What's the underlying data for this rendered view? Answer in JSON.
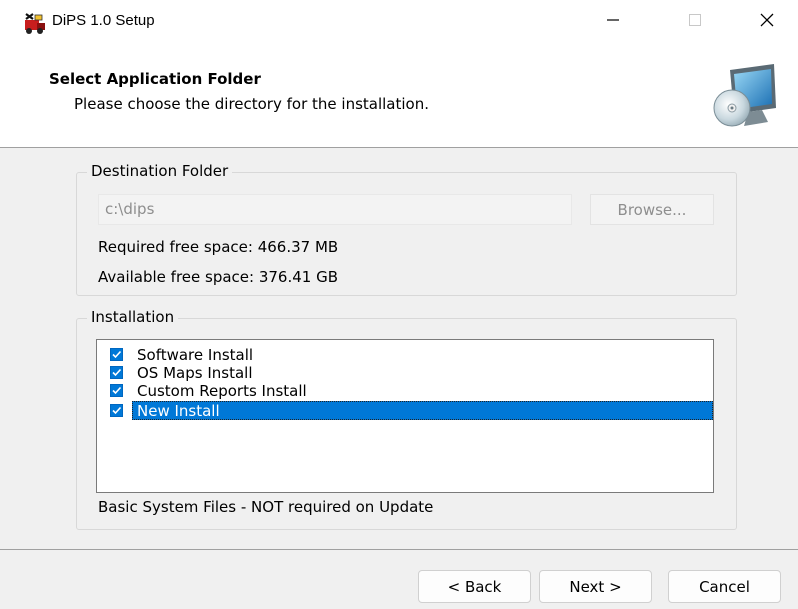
{
  "window": {
    "title": "DiPS 1.0 Setup",
    "icons": {
      "app": "dips-setup-icon",
      "minimize": "minimize-icon",
      "maximize": "maximize-icon",
      "close": "close-icon"
    }
  },
  "header": {
    "title": "Select Application Folder",
    "subtitle": "Please choose the directory for the installation.",
    "graphic": "computer-install-icon"
  },
  "destination": {
    "group_label": "Destination Folder",
    "path_value": "c:\\dips",
    "browse_label": "Browse...",
    "required_space": "Required free space: 466.37 MB",
    "available_space": "Available free space: 376.41 GB"
  },
  "installation": {
    "group_label": "Installation",
    "items": [
      {
        "label": "Software Install",
        "checked": true,
        "selected": false
      },
      {
        "label": "OS Maps Install",
        "checked": true,
        "selected": false
      },
      {
        "label": "Custom Reports Install",
        "checked": true,
        "selected": false
      },
      {
        "label": "New Install",
        "checked": true,
        "selected": true
      }
    ],
    "description": "Basic System Files - NOT required on Update"
  },
  "footer": {
    "back_label": "< Back",
    "next_label": "Next >",
    "cancel_label": "Cancel"
  },
  "colors": {
    "selection": "#0078d7",
    "checkbox": "#0078d7",
    "window_bg": "#f0f0f0",
    "header_bg": "#ffffff"
  }
}
